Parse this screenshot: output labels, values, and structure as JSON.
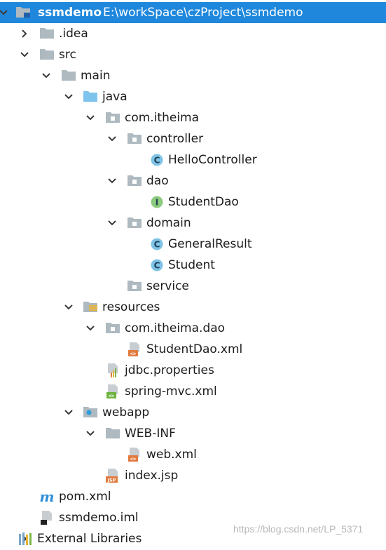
{
  "project": {
    "name": "ssmdemo",
    "path": "E:\\workSpace\\czProject\\ssmdemo"
  },
  "tree": [
    {
      "label": "ssmdemo",
      "icon": "module-folder-icon",
      "expanded": true,
      "selected": true
    },
    {
      "label": ".idea",
      "icon": "folder-icon",
      "expanded": false
    },
    {
      "label": "src",
      "icon": "folder-icon",
      "expanded": true
    },
    {
      "label": "main",
      "icon": "folder-icon",
      "expanded": true
    },
    {
      "label": "java",
      "icon": "source-folder-icon",
      "expanded": true
    },
    {
      "label": "com.itheima",
      "icon": "package-icon",
      "expanded": true
    },
    {
      "label": "controller",
      "icon": "package-icon",
      "expanded": true
    },
    {
      "label": "HelloController",
      "icon": "class-icon"
    },
    {
      "label": "dao",
      "icon": "package-icon",
      "expanded": true
    },
    {
      "label": "StudentDao",
      "icon": "interface-icon"
    },
    {
      "label": "domain",
      "icon": "package-icon",
      "expanded": true
    },
    {
      "label": "GeneralResult",
      "icon": "class-icon"
    },
    {
      "label": "Student",
      "icon": "class-icon"
    },
    {
      "label": "service",
      "icon": "package-icon"
    },
    {
      "label": "resources",
      "icon": "resources-folder-icon",
      "expanded": true
    },
    {
      "label": "com.itheima.dao",
      "icon": "package-icon",
      "expanded": true
    },
    {
      "label": "StudentDao.xml",
      "icon": "xml-file-icon"
    },
    {
      "label": "jdbc.properties",
      "icon": "properties-file-icon"
    },
    {
      "label": "spring-mvc.xml",
      "icon": "spring-xml-icon"
    },
    {
      "label": "webapp",
      "icon": "web-folder-icon",
      "expanded": true
    },
    {
      "label": "WEB-INF",
      "icon": "folder-icon",
      "expanded": true
    },
    {
      "label": "web.xml",
      "icon": "xml-file-icon"
    },
    {
      "label": "index.jsp",
      "icon": "jsp-file-icon"
    },
    {
      "label": "pom.xml",
      "icon": "maven-icon"
    },
    {
      "label": "ssmdemo.iml",
      "icon": "iml-file-icon"
    },
    {
      "label": "External Libraries",
      "icon": "libraries-icon",
      "expanded": false
    }
  ],
  "watermark": "https://blog.csdn.net/LP_5371",
  "colors": {
    "selection": "#1f88dc",
    "class": "#5bb4dc",
    "interface": "#7ec27e",
    "folder": "#aeb9c0",
    "source_folder": "#7ec3ec"
  }
}
